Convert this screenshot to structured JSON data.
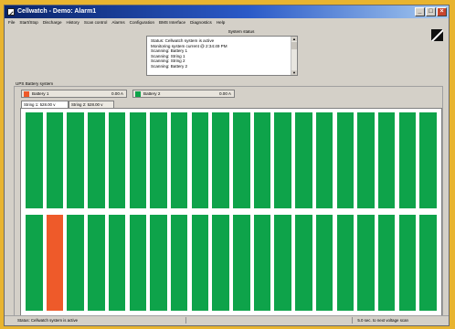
{
  "window": {
    "title": "Cellwatch - Demo: Alarm1"
  },
  "menu": [
    "File",
    "Start/Stop",
    "Discharge",
    "History",
    "Scan control",
    "Alarms",
    "Configuration",
    "BMS Interface",
    "Diagnostics",
    "Help"
  ],
  "status": {
    "title": "System status",
    "lines": [
      "Status: Cellwatch system is active",
      "Monitoring system current @ 2:34:49 PM",
      "Scanning: Battery 1",
      "Scanning: String 1",
      "Scanning: String 2",
      "Scanning: Battery 2"
    ]
  },
  "section": {
    "label": "UPS Battery system"
  },
  "batteries": [
    {
      "name": "Battery 1",
      "value": "0.00 A",
      "color": "#ee5a2a"
    },
    {
      "name": "Battery 2",
      "value": "0.00 A",
      "color": "#0ea34a"
    }
  ],
  "strings": [
    {
      "label": "String 1: 528.00 v"
    },
    {
      "label": "String 2: 528.00 v"
    }
  ],
  "cells": {
    "columns": 20,
    "rows": 2,
    "ok_color": "#0ea34a",
    "alarm_color": "#ee5a2a",
    "alarm": [
      {
        "row": 1,
        "col": 1
      }
    ]
  },
  "statusbar": {
    "left": "Status: Cellwatch system is active",
    "right": "5.0 sec. to next voltage scan"
  }
}
